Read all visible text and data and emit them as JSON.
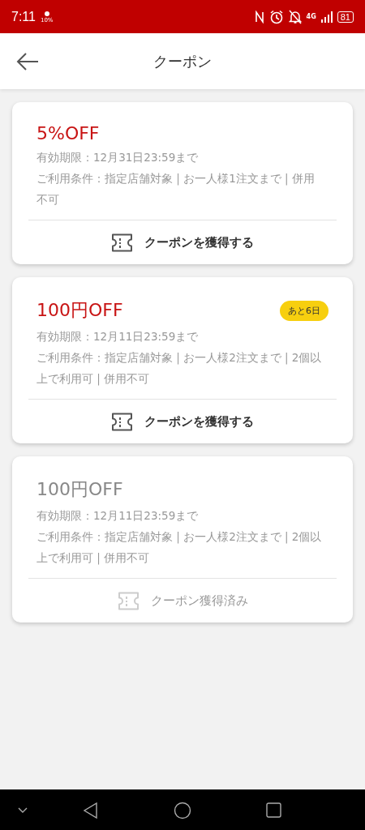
{
  "status_bar": {
    "time": "7:11",
    "brightness": "10%",
    "network": "4G",
    "battery": "81"
  },
  "header": {
    "title": "クーポン"
  },
  "coupons": [
    {
      "title": "5%OFF",
      "expiry": "有効期限：12月31日23:59まで",
      "conditions": "ご利用条件：指定店舗対象 | お一人様1注文まで | 併用不可",
      "claimed": false,
      "action": "クーポンを獲得する"
    },
    {
      "title": "100円OFF",
      "badge": "あと6日",
      "expiry": "有効期限：12月11日23:59まで",
      "conditions": "ご利用条件：指定店舗対象 | お一人様2注文まで | 2個以上で利用可 | 併用不可",
      "claimed": false,
      "action": "クーポンを獲得する"
    },
    {
      "title": "100円OFF",
      "expiry": "有効期限：12月11日23:59まで",
      "conditions": "ご利用条件：指定店舗対象 | お一人様2注文まで | 2個以上で利用可 | 併用不可",
      "claimed": true,
      "action": "クーポン獲得済み"
    }
  ]
}
